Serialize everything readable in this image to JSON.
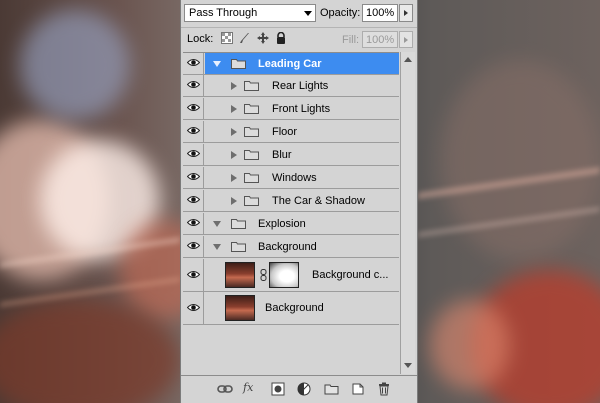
{
  "panel": {
    "blend_mode": "Pass Through",
    "opacity_label": "Opacity:",
    "opacity_value": "100%",
    "lock_label": "Lock:",
    "fill_label": "Fill:",
    "fill_value": "100%"
  },
  "layers": [
    {
      "name": "Leading Car",
      "type": "group",
      "expanded": true,
      "selected": true,
      "indent": 0
    },
    {
      "name": "Rear Lights",
      "type": "group",
      "expanded": false,
      "indent": 1
    },
    {
      "name": "Front Lights",
      "type": "group",
      "expanded": false,
      "indent": 1
    },
    {
      "name": "Floor",
      "type": "group",
      "expanded": false,
      "indent": 1
    },
    {
      "name": "Blur",
      "type": "group",
      "expanded": false,
      "indent": 1
    },
    {
      "name": "Windows",
      "type": "group",
      "expanded": false,
      "indent": 1
    },
    {
      "name": "The Car & Shadow",
      "type": "group",
      "expanded": false,
      "indent": 1
    },
    {
      "name": "Explosion",
      "type": "group",
      "expanded": true,
      "indent": 0
    },
    {
      "name": "Background",
      "type": "group",
      "expanded": true,
      "indent": 0
    },
    {
      "name": "Background c...",
      "type": "layer-with-mask",
      "indent": 1
    },
    {
      "name": "Background",
      "type": "layer",
      "indent": 1
    }
  ],
  "toolbar": {
    "fx_label": "fx",
    "icons": [
      "link-layers-icon",
      "fx-icon",
      "add-mask-icon",
      "adjustment-layer-icon",
      "new-group-icon",
      "new-layer-icon",
      "trash-icon"
    ]
  },
  "colors": {
    "panel_bg": "#d4d4d4",
    "selection": "#3d8cf0"
  }
}
